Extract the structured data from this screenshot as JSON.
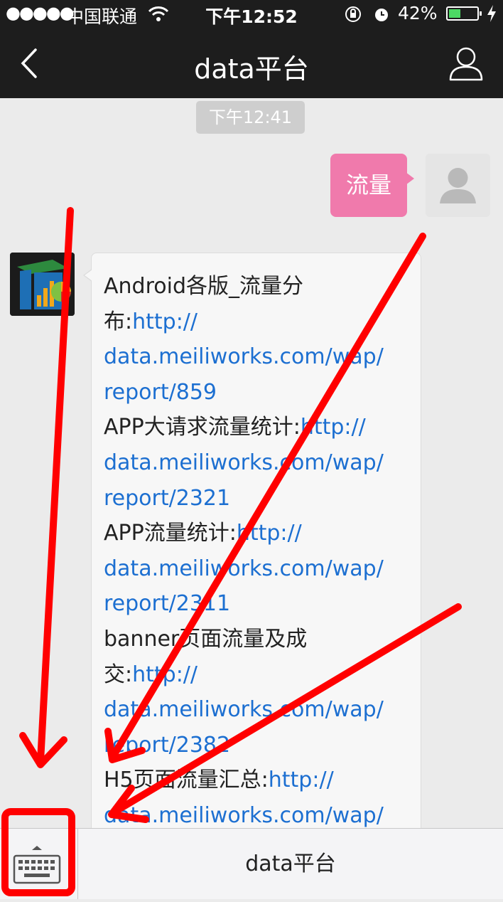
{
  "status_bar": {
    "signal": "●●●●●",
    "carrier": "中国联通",
    "time": "下午12:52",
    "battery_percent": "42%",
    "battery_level": 0.42,
    "battery_color": "#4cd964"
  },
  "nav": {
    "title": "data平台",
    "back_icon": "chevron-left-icon",
    "profile_icon": "person-icon"
  },
  "chat": {
    "timestamp": "下午12:41",
    "outgoing": {
      "text": "流量",
      "color": "#f07aac"
    },
    "incoming": {
      "lines": [
        {
          "text": "Android各版_流量分",
          "link": ""
        },
        {
          "text": "布:",
          "link": "http://"
        },
        {
          "text": "",
          "link": "data.meiliworks.com/wap/"
        },
        {
          "text": "",
          "link": "report/859"
        },
        {
          "text": "APP大请求流量统计:",
          "link": "http://"
        },
        {
          "text": "",
          "link": "data.meiliworks.com/wap/"
        },
        {
          "text": "",
          "link": "report/2321"
        },
        {
          "text": "APP流量统计:",
          "link": "http://"
        },
        {
          "text": "",
          "link": "data.meiliworks.com/wap/"
        },
        {
          "text": "",
          "link": "report/2311"
        },
        {
          "text": "banner页面流量及成",
          "link": ""
        },
        {
          "text": "交:",
          "link": "http://"
        },
        {
          "text": "",
          "link": "data.meiliworks.com/wap/"
        },
        {
          "text": "",
          "link": "report/2382"
        },
        {
          "text": "H5页面流量汇总:",
          "link": "http://"
        },
        {
          "text": "",
          "link": "data.meiliworks.com/wap/"
        }
      ]
    }
  },
  "bottom_bar": {
    "keyboard_icon": "keyboard-icon",
    "menu_label": "data平台"
  },
  "annotation": {
    "color": "#ff0000"
  }
}
